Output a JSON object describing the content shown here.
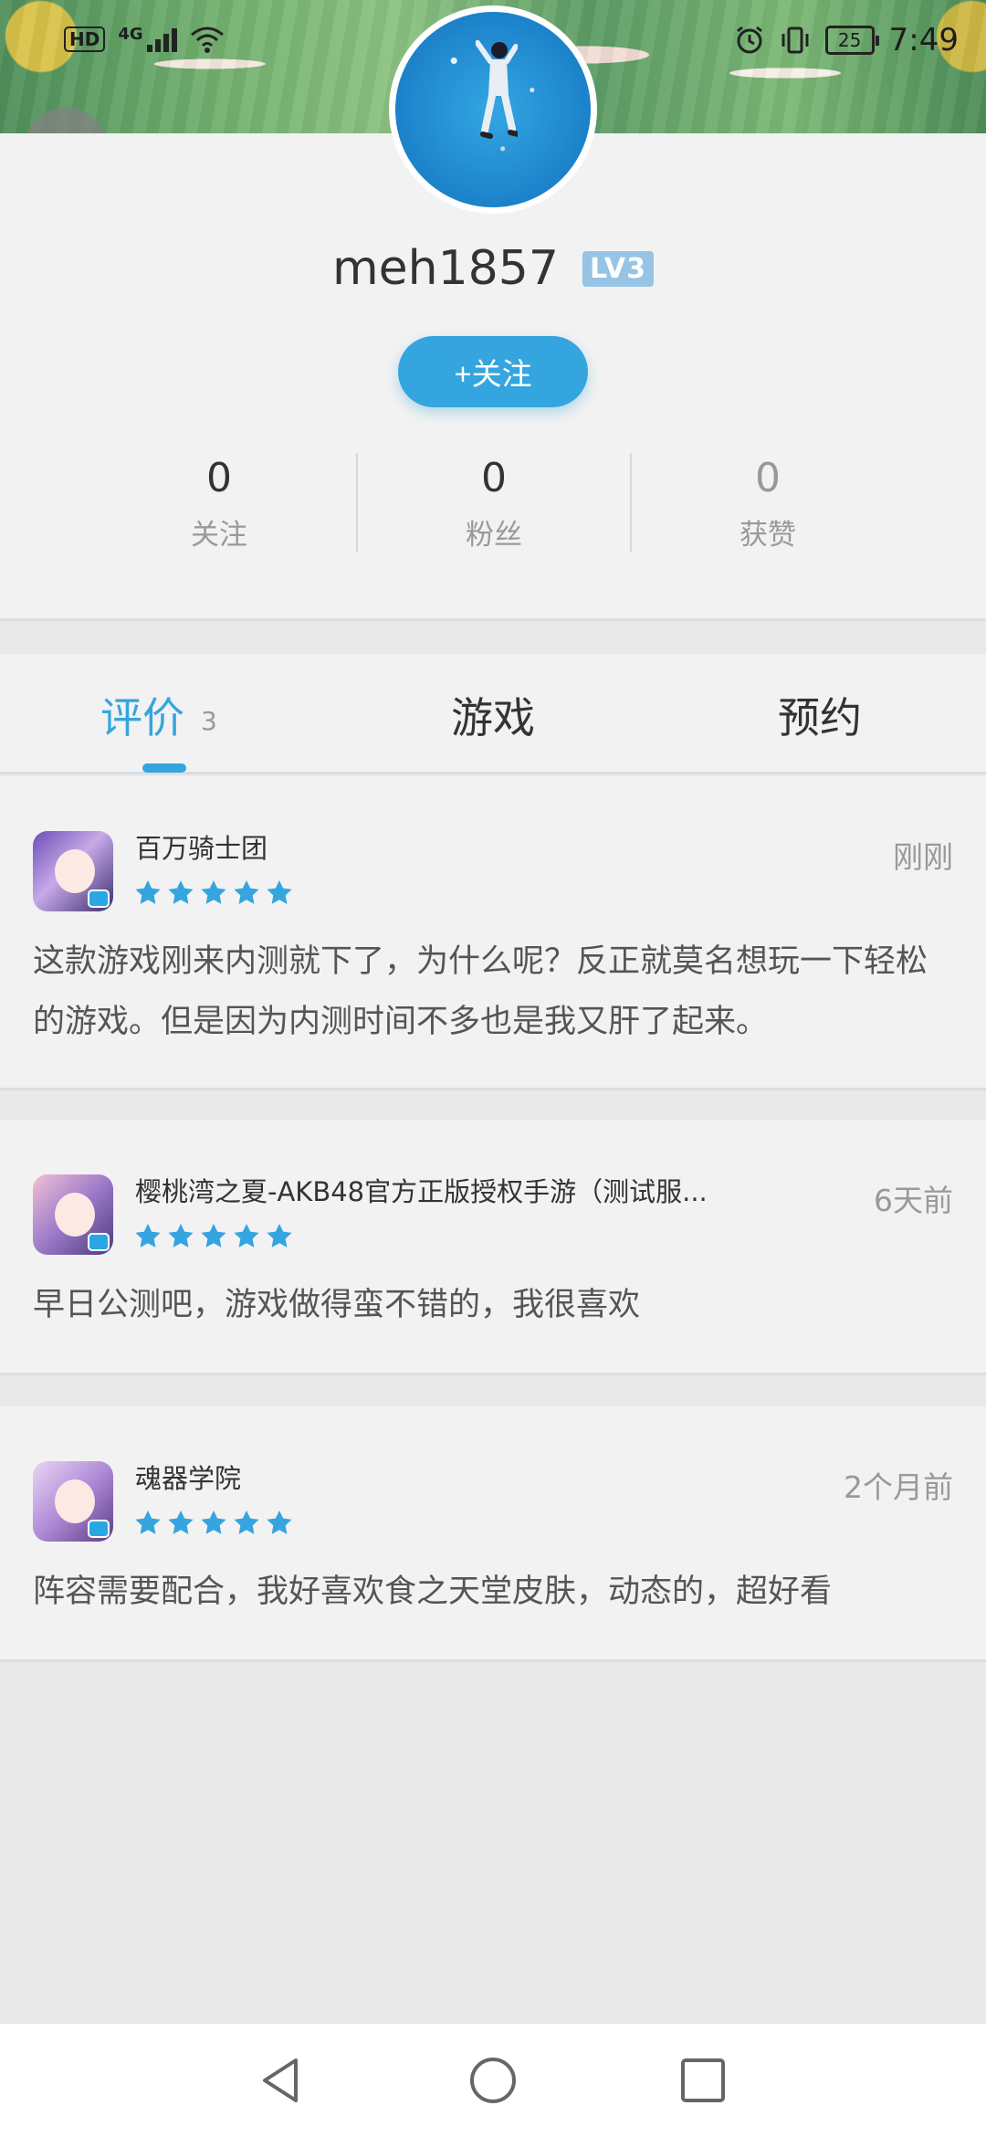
{
  "status_bar": {
    "hd": "HD",
    "network": "4G",
    "battery": "25",
    "time": "7:49"
  },
  "profile": {
    "username": "meh1857",
    "level": "LV3",
    "follow_label": "+关注",
    "stats": [
      {
        "value": "0",
        "label": "关注"
      },
      {
        "value": "0",
        "label": "粉丝"
      },
      {
        "value": "0",
        "label": "获赞"
      }
    ]
  },
  "tabs": {
    "reviews": {
      "label": "评价",
      "count": "3"
    },
    "games": {
      "label": "游戏"
    },
    "reservations": {
      "label": "预约"
    }
  },
  "reviews": [
    {
      "game": "百万骑士团",
      "rating": 5,
      "time": "刚刚",
      "text": "这款游戏刚来内测就下了，为什么呢？反正就莫名想玩一下轻松的游戏。但是因为内测时间不多也是我又肝了起来。"
    },
    {
      "game": "樱桃湾之夏-AKB48官方正版授权手游（测试服...",
      "rating": 5,
      "time": "6天前",
      "text": "早日公测吧，游戏做得蛮不错的，我很喜欢"
    },
    {
      "game": "魂器学院",
      "rating": 5,
      "time": "2个月前",
      "text": "阵容需要配合，我好喜欢食之天堂皮肤，动态的，超好看"
    }
  ],
  "colors": {
    "accent": "#34a5de",
    "text": "#333333",
    "muted": "#999999",
    "background": "#e9e9e9",
    "card": "#f2f2f2"
  },
  "icons": {
    "back": "arrow-left-icon",
    "star": "star-icon",
    "nav_back": "triangle-back-icon",
    "nav_home": "circle-home-icon",
    "nav_recent": "square-recent-icon"
  }
}
